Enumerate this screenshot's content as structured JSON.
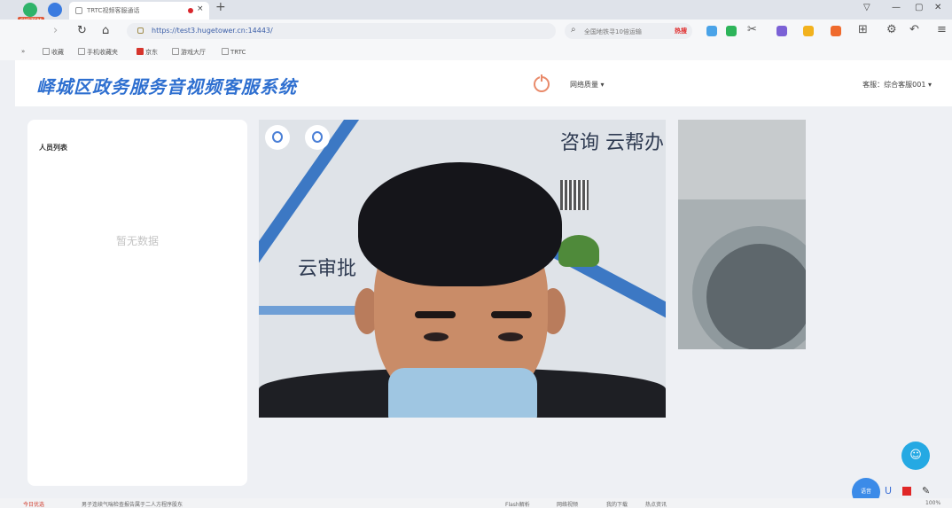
{
  "browser": {
    "badge": "SYSTEM",
    "tab_title": "TRTC视频客服通话",
    "tab_close": "×",
    "new_tab": "+",
    "url": "https://test3.hugetower.cn:14443/",
    "search_placeholder": "全国地铁寻10倍运输",
    "search_hot": "热搜",
    "bookmarks": [
      "收藏",
      "手机收藏夹",
      "京东",
      "游戏大厅",
      "TRTC"
    ]
  },
  "header": {
    "title": "峄城区政务服务音视频客服系统",
    "network_menu": "网络质量 ▾",
    "agent_menu": "客服：综合客服001 ▾"
  },
  "left_panel": {
    "title": "人员列表",
    "empty": "暂无数据"
  },
  "video": {
    "wall_text_top": "咨询  云帮办",
    "wall_text_mid": "云审批"
  },
  "float": {
    "chat_glyph": "☺",
    "tool_label": "语音"
  },
  "status": {
    "left": "今日优选",
    "news": "男子连续气喘检查报告属于二人方程序股东",
    "items": [
      "Flash解析",
      "网络视频",
      "我的下载",
      "热点资讯"
    ],
    "zoom": "100%"
  }
}
